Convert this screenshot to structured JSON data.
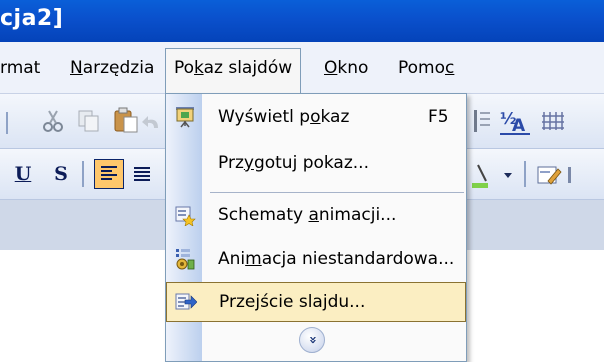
{
  "titlebar": {
    "title_visible": "cja2]"
  },
  "menubar": {
    "items": [
      {
        "label_pre": "rmat",
        "underline": "",
        "label_post": ""
      },
      {
        "label_pre": "",
        "underline": "N",
        "label_post": "arzędzia"
      },
      {
        "label_pre": "Po",
        "underline": "k",
        "label_post": "az slajdów"
      },
      {
        "label_pre": "",
        "underline": "O",
        "label_post": "kno"
      },
      {
        "label_pre": "Pomo",
        "underline": "c",
        "label_post": ""
      }
    ],
    "open_index": 2
  },
  "toolbar2": {
    "underline_btn": "U",
    "shadow_btn": "S"
  },
  "dropdown": {
    "items": [
      {
        "label_pre": "Wyświetl p",
        "underline": "o",
        "label_post": "kaz",
        "shortcut": "F5",
        "icon": "slideshow-icon",
        "highlighted": false
      },
      {
        "label_pre": "Prz",
        "underline": "y",
        "label_post": "gotuj pokaz...",
        "shortcut": "",
        "icon": "",
        "highlighted": false
      },
      {
        "label_pre": "Schematy ",
        "underline": "a",
        "label_post": "nimacji...",
        "shortcut": "",
        "icon": "animation-scheme-icon",
        "highlighted": false
      },
      {
        "label_pre": "Ani",
        "underline": "m",
        "label_post": "acja niestandardowa...",
        "shortcut": "",
        "icon": "custom-animation-icon",
        "highlighted": false
      },
      {
        "label_pre": "Prze",
        "underline": "j",
        "label_post": "ście slajdu...",
        "shortcut": "",
        "icon": "slide-transition-icon",
        "highlighted": true
      }
    ],
    "expand_label": "»"
  },
  "colors": {
    "title_bar": "#0a50cc",
    "menu_highlight": "#fbeec2",
    "menu_highlight_border": "#8a7232",
    "active_button": "#ffc76b"
  }
}
